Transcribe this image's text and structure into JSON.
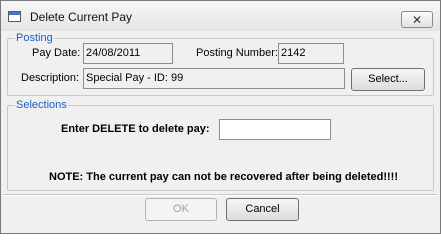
{
  "window": {
    "title": "Delete Current Pay",
    "close_glyph": "✕"
  },
  "posting": {
    "legend": "Posting",
    "pay_date_label": "Pay Date:",
    "pay_date_value": "24/08/2011",
    "posting_number_label": "Posting Number:",
    "posting_number_value": "2142",
    "description_label": "Description:",
    "description_value": "Special Pay - ID: 99",
    "select_button": "Select..."
  },
  "selections": {
    "legend": "Selections",
    "prompt_label": "Enter DELETE to delete pay:",
    "delete_input_value": "",
    "note": "NOTE: The current pay can not be recovered after being deleted!!!!"
  },
  "footer": {
    "ok_label": "OK",
    "cancel_label": "Cancel"
  }
}
